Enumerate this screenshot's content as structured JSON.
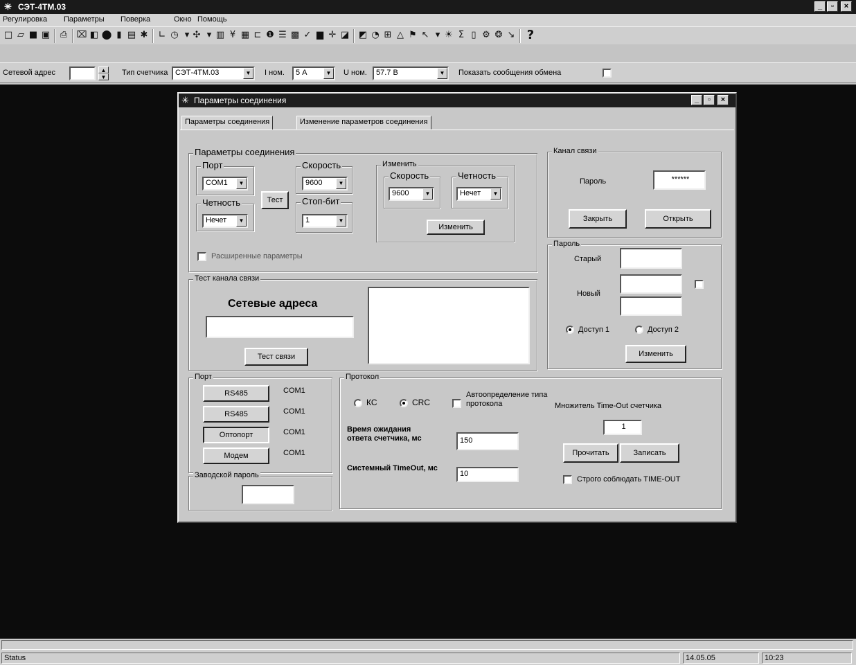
{
  "app": {
    "title": "СЭТ-4ТМ.03",
    "window_buttons": [
      "_",
      "▫",
      "×"
    ]
  },
  "menu": [
    "Регулировка",
    "Параметры",
    "Поверка",
    "Окно",
    "Помощь"
  ],
  "param_bar": {
    "net_address_label": "Сетевой адрес",
    "net_address_value": "",
    "meter_type_label": "Тип счетчика",
    "meter_type_value": "СЭТ-4ТМ.03",
    "inom_label": "I ном.",
    "inom_value": "5 А",
    "unom_label": "U ном.",
    "unom_value": "57.7 В",
    "show_messages_label": "Показать сообщения обмена"
  },
  "dialog": {
    "title": "Параметры соединения",
    "tabs": [
      "Параметры соединения",
      "Изменение параметров соединения"
    ],
    "conn_params": {
      "title": "Параметры соединения",
      "port_group": "Порт",
      "port_value": "COM1",
      "parity_group": "Четность",
      "parity_value": "Нечет",
      "test_button": "Тест",
      "speed_group": "Скорость",
      "speed_value": "9600",
      "stopbit_group": "Стоп-бит",
      "stopbit_value": "1",
      "change_group": "Изменить",
      "change_speed_group": "Скорость",
      "change_speed_value": "9600",
      "change_parity_group": "Четность",
      "change_parity_value": "Нечет",
      "change_button": "Изменить",
      "extended_label": "Расширенные параметры"
    },
    "channel": {
      "title": "Канал связи",
      "password_label": "Пароль",
      "password_value": "******",
      "close_button": "Закрыть",
      "open_button": "Открыть"
    },
    "password": {
      "title": "Пароль",
      "old_label": "Старый",
      "new_label": "Новый",
      "access1": "Доступ 1",
      "access2": "Доступ 2",
      "change_button": "Изменить"
    },
    "test_channel": {
      "title": "Тест канала связи",
      "net_addresses_label": "Сетевые адреса",
      "test_button": "Тест связи"
    },
    "port": {
      "title": "Порт",
      "rows": [
        {
          "button": "RS485",
          "com": "COM1"
        },
        {
          "button": "RS485",
          "com": "COM1"
        },
        {
          "button": "Оптопорт",
          "com": "COM1"
        },
        {
          "button": "Модем",
          "com": "COM1"
        }
      ]
    },
    "factory_password": {
      "title": "Заводской пароль"
    },
    "protocol": {
      "title": "Протокол",
      "ks": "КС",
      "crc": "CRC",
      "auto_detect": "Автоопределение типа протокола",
      "wait_label": "Время ожидания ответа счетчика, мс",
      "wait_value": "150",
      "sys_timeout_label": "Системный TimeOut, мс",
      "sys_timeout_value": "10",
      "multiplier_label": "Множитель Time-Out счетчика",
      "multiplier_value": "1",
      "read_button": "Прочитать",
      "write_button": "Записать",
      "strict_label": "Строго соблюдать TIME-OUT"
    }
  },
  "status_bar": {
    "status": "Status",
    "date": "14.05.05",
    "time": "10:23"
  }
}
